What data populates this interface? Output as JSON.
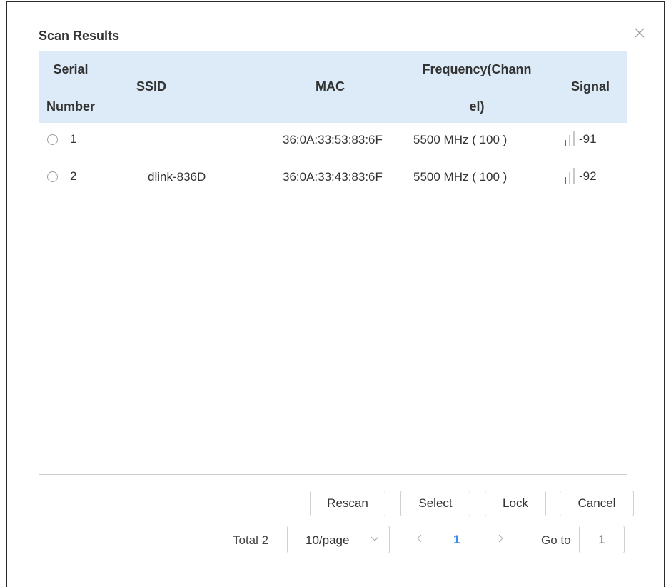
{
  "dialog": {
    "title": "Scan Results"
  },
  "table": {
    "headers": {
      "serial_line1": "Serial",
      "serial_line2": "Number",
      "ssid": "SSID",
      "mac": "MAC",
      "freq_line1": "Frequency(Chann",
      "freq_line2": "el)",
      "signal": "Signal"
    },
    "rows": [
      {
        "index": "1",
        "ssid": "",
        "mac": "36:0A:33:53:83:6F",
        "frequency": "5500 MHz ( 100 )",
        "signal": "-91",
        "signal_bars_active": 1
      },
      {
        "index": "2",
        "ssid": "dlink-836D",
        "mac": "36:0A:33:43:83:6F",
        "frequency": "5500 MHz ( 100 )",
        "signal": "-92",
        "signal_bars_active": 1
      }
    ]
  },
  "buttons": {
    "rescan": "Rescan",
    "select": "Select",
    "lock": "Lock",
    "cancel": "Cancel"
  },
  "pagination": {
    "total": "Total 2",
    "page_size": "10/page",
    "current_page": "1",
    "goto_label": "Go to",
    "goto_value": "1"
  },
  "colors": {
    "header_bg": "#dcebf7",
    "signal_active": "#d9343f",
    "page_active": "#3a8ee6"
  }
}
